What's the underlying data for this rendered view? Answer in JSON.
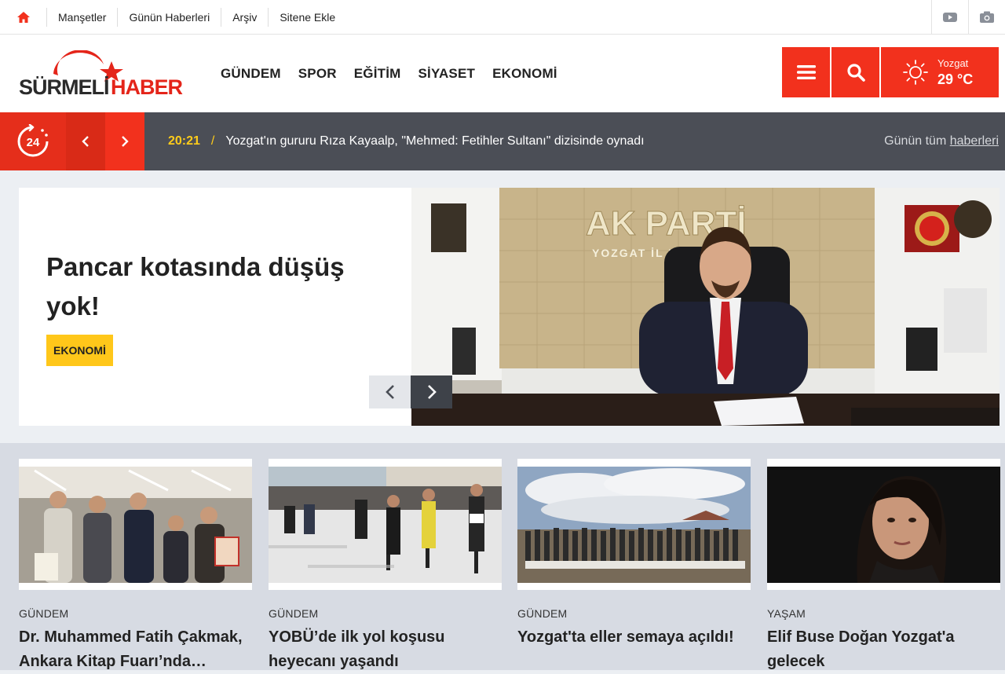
{
  "topbar": {
    "links": [
      "Manşetler",
      "Günün Haberleri",
      "Arşiv",
      "Sitene Ekle"
    ]
  },
  "header": {
    "logo_left": "SÜRMELİ",
    "logo_right": "HABER",
    "nav": [
      "GÜNDEM",
      "SPOR",
      "EĞİTİM",
      "SİYASET",
      "EKONOMİ"
    ],
    "weather": {
      "city": "Yozgat",
      "temp": "29 °C"
    }
  },
  "ticker": {
    "badge": "24",
    "time": "20:21",
    "separator": "/",
    "headline": "Yozgat'ın gururu Rıza Kayaalp, \"Mehmed: Fetihler Sultanı\" dizisinde oynadı",
    "all_prefix": "Günün tüm",
    "all_link": "haberleri"
  },
  "hero": {
    "title": "Pancar kotasında düşüş yok!",
    "category": "EKONOMİ",
    "sign_line1": "AK PARTİ",
    "sign_line2": "YOZGAT İL BAŞKANLIĞI"
  },
  "cards": [
    {
      "category": "GÜNDEM",
      "title": "Dr. Muhammed Fatih Çakmak, Ankara Kitap Fuarı’nda…"
    },
    {
      "category": "GÜNDEM",
      "title": "YOBÜ’de ilk yol koşusu heyecanı yaşandı"
    },
    {
      "category": "GÜNDEM",
      "title": "Yozgat'ta eller semaya açıldı!"
    },
    {
      "category": "YAŞAM",
      "title": "Elif Buse Doğan Yozgat'a gelecek"
    }
  ],
  "colors": {
    "accent": "#f2311d",
    "ticker_bg": "#4b4e56",
    "badge_yellow": "#ffc71a"
  }
}
